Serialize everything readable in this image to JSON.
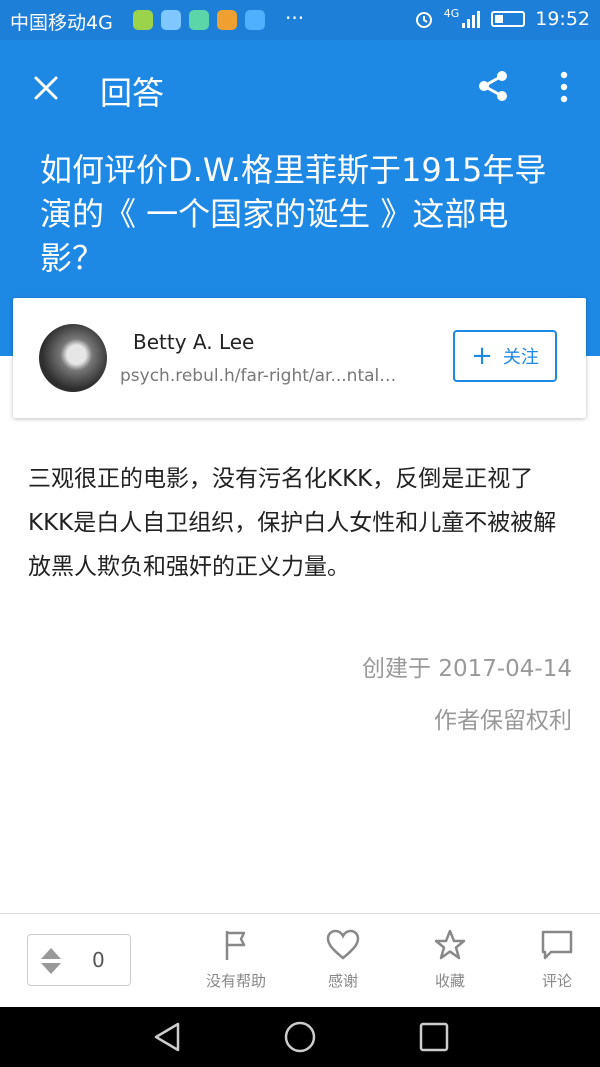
{
  "status_bar": {
    "carrier": "中国移动4G",
    "more": "···",
    "network": "4G",
    "time": "19:52",
    "app_colors": [
      "#9bd44a",
      "#7ec8ff",
      "#5bd6a8",
      "#f0a030",
      "#4fb0ff"
    ]
  },
  "header": {
    "title": "回答",
    "question": "如何评价D.W.格里菲斯于1915年导演的《 一个国家的诞生 》这部电影？",
    "background": "#1e88e5"
  },
  "author": {
    "name": "Betty A. Lee",
    "bio": "psych.rebul.h/far-right/ar...ntal…",
    "follow_label": "关注"
  },
  "answer": {
    "body": "三观很正的电影，没有污名化KKK，反倒是正视了KKK是白人自卫组织，保护白人女性和儿童不被被解放黑人欺负和强奸的正义力量。",
    "created": "创建于 2017-04-14",
    "rights": "作者保留权利"
  },
  "bottom": {
    "vote_count": "0",
    "actions": [
      {
        "label": "没有帮助",
        "icon": "flag-icon"
      },
      {
        "label": "感谢",
        "icon": "heart-icon"
      },
      {
        "label": "收藏",
        "icon": "star-icon"
      },
      {
        "label": "评论",
        "icon": "comment-icon"
      }
    ]
  }
}
